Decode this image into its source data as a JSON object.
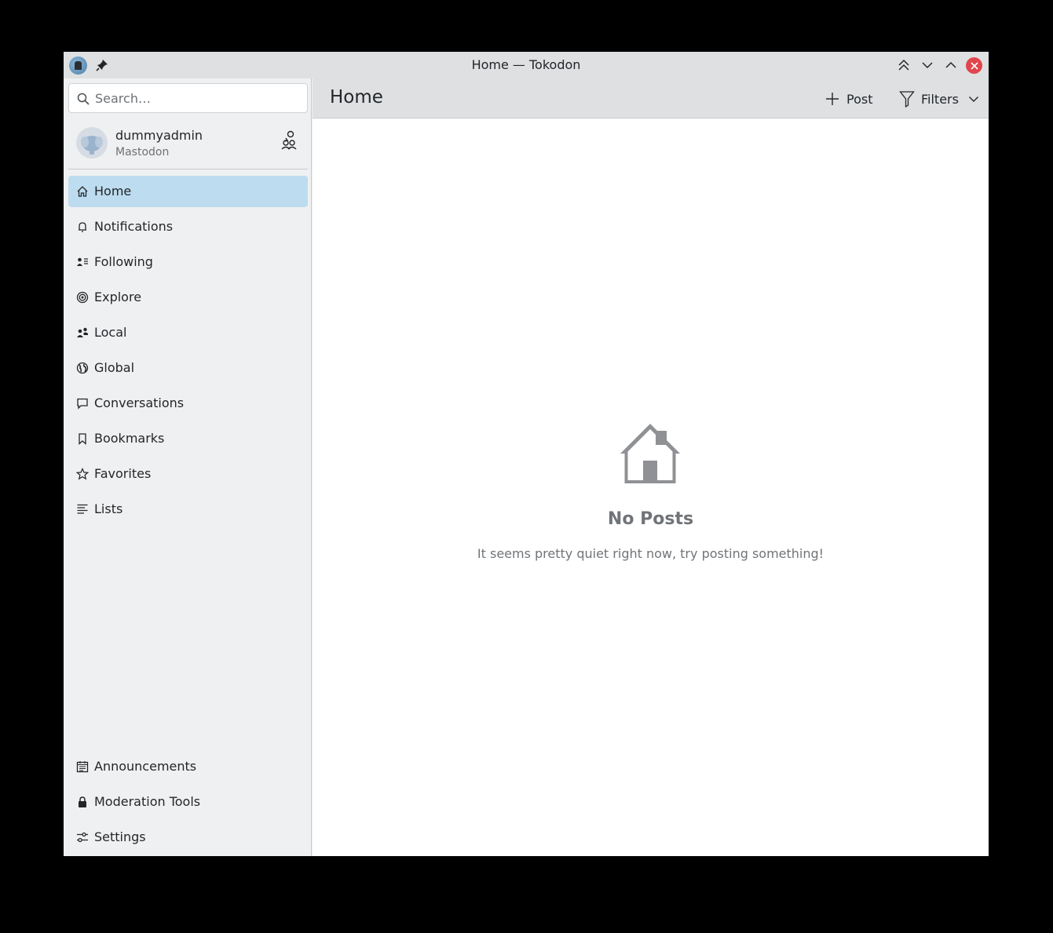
{
  "window": {
    "title": "Home — Tokodon"
  },
  "search": {
    "placeholder": "Search…"
  },
  "account": {
    "username": "dummyadmin",
    "server": "Mastodon"
  },
  "nav": {
    "home": "Home",
    "notifications": "Notifications",
    "following": "Following",
    "explore": "Explore",
    "local": "Local",
    "global": "Global",
    "conversations": "Conversations",
    "bookmarks": "Bookmarks",
    "favorites": "Favorites",
    "lists": "Lists",
    "announcements": "Announcements",
    "moderation": "Moderation Tools",
    "settings": "Settings"
  },
  "header": {
    "title": "Home",
    "post_label": "Post",
    "filters_label": "Filters"
  },
  "empty": {
    "title": "No Posts",
    "subtitle": "It seems pretty quiet right now, try posting something!"
  },
  "colors": {
    "active_item": "#bddcef",
    "close_button": "#e0464e",
    "text": "#232629",
    "muted": "#707478"
  }
}
